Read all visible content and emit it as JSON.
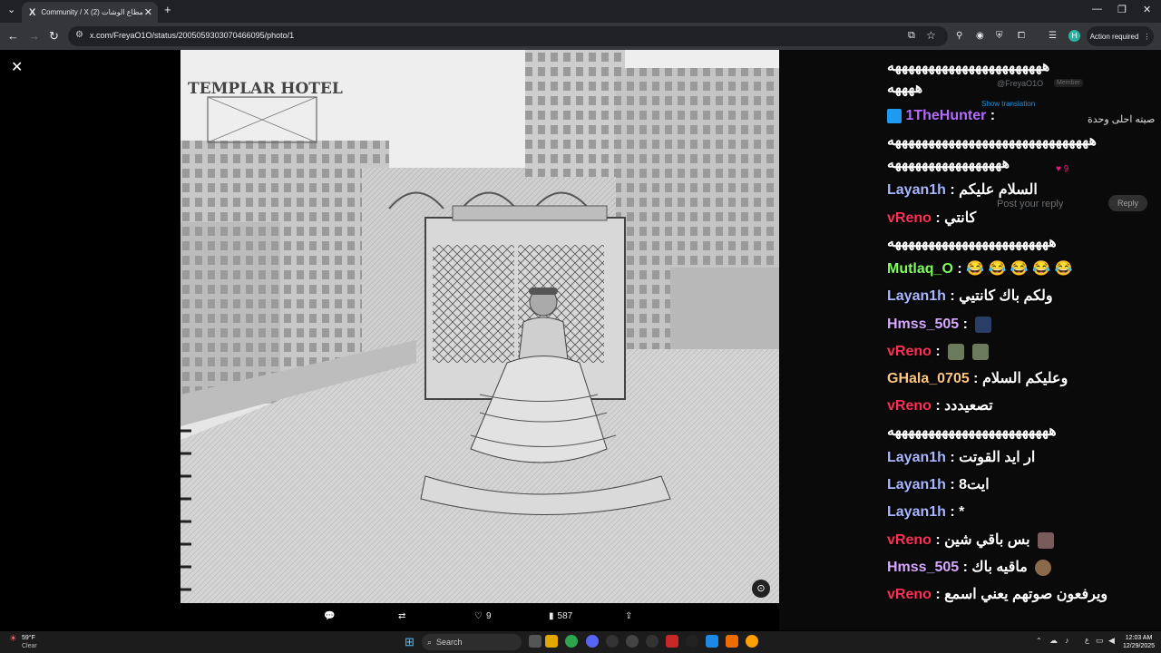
{
  "browser": {
    "tab_title": "Community / X مطاع الوشات (2)",
    "tab_logo": "X",
    "url": "x.com/FreyaO1O/status/2005059303070466095/photo/1",
    "action_required": "Action required",
    "profile_initial": "H"
  },
  "viewer": {
    "photo_sign_hotel": "TEMPLAR HOTEL",
    "actions": {
      "likes": "9",
      "views": "587"
    }
  },
  "tweet_panel": {
    "handle": "@FreyaO1O",
    "badge": "Member",
    "show_translation": "Show translation",
    "text": "صيته احلى وحدة",
    "likes": "9",
    "reply_placeholder": "Post your reply",
    "reply_button": "Reply"
  },
  "chat": [
    {
      "user": "",
      "msg": "هههههههههههههههههههههههه"
    },
    {
      "user": "",
      "msg": "ههههه"
    },
    {
      "user": "1TheHunter",
      "msg": ""
    },
    {
      "user": "",
      "msg": "ههههههههههههههههههههههههههههههه"
    },
    {
      "user": "",
      "msg": "هههههههههههههههههه"
    },
    {
      "user": "Layan1h",
      "msg": "السلام عليكم"
    },
    {
      "user": "vReno",
      "msg": "كانتي"
    },
    {
      "user": "",
      "msg": "ههههههههههههههههههههههههه"
    },
    {
      "user": "Mutlaq_O",
      "msg": "😂 😂 😂 😂 😂"
    },
    {
      "user": "Layan1h",
      "msg": "ولكم باك كانتيي"
    },
    {
      "user": "Hmss_505",
      "msg": ""
    },
    {
      "user": "vReno",
      "msg": ""
    },
    {
      "user": "GHala_0705",
      "msg": "وعليكم السلام"
    },
    {
      "user": "vReno",
      "msg": "تصعيددد"
    },
    {
      "user": "",
      "msg": "ههههههههههههههههههههههههه"
    },
    {
      "user": "Layan1h",
      "msg": "ار ايد القوتت"
    },
    {
      "user": "Layan1h",
      "msg": "ايت8"
    },
    {
      "user": "Layan1h",
      "msg": "*"
    },
    {
      "user": "vReno",
      "msg": "بس باقي شين"
    },
    {
      "user": "Hmss_505",
      "msg": "ماقيه باك"
    },
    {
      "user": "vReno",
      "msg": "ويرفعون صوتهم يعني اسمع"
    }
  ],
  "taskbar": {
    "weather_temp": "59°F",
    "weather_desc": "Clear",
    "search_label": "Search",
    "time": "12:03 AM",
    "date": "12/29/2025"
  },
  "colors": {
    "reno": "#ff2f55",
    "layan": "#a9b7ff",
    "mutlaq": "#7cff5a",
    "hmss": "#d7a8ff",
    "ghala": "#ffc680",
    "hunter": "#b66cff"
  }
}
